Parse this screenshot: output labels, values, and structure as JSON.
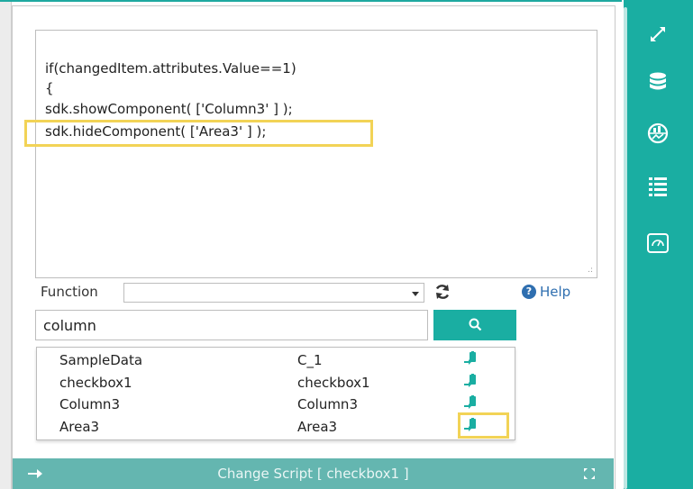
{
  "editor": {
    "code_lines": [
      "if(changedItem.attributes.Value==1)",
      "{",
      "sdk.showComponent( ['Column3' ] );",
      "sdk.hideComponent( ['Area3' ] );"
    ]
  },
  "function_row": {
    "label": "Function",
    "selected": "",
    "help_label": "Help"
  },
  "search": {
    "value": "column"
  },
  "results": [
    {
      "name": "SampleData",
      "id": "C_1"
    },
    {
      "name": "checkbox1",
      "id": "checkbox1"
    },
    {
      "name": "Column3",
      "id": "Column3"
    },
    {
      "name": "Area3",
      "id": "Area3"
    }
  ],
  "bottom_bar": {
    "title": "Change Script [ checkbox1 ]"
  },
  "colors": {
    "accent": "#1aaea2",
    "bottom_bar": "#64b6b0",
    "highlight": "#f2d356",
    "help": "#2f6fb0"
  },
  "icons": [
    "expand-icon",
    "database-icon",
    "globe-chart-icon",
    "list-icon",
    "gauge-icon",
    "refresh-icon",
    "search-icon",
    "insert-icon",
    "arrow-right-icon",
    "fullscreen-icon",
    "help-icon"
  ]
}
